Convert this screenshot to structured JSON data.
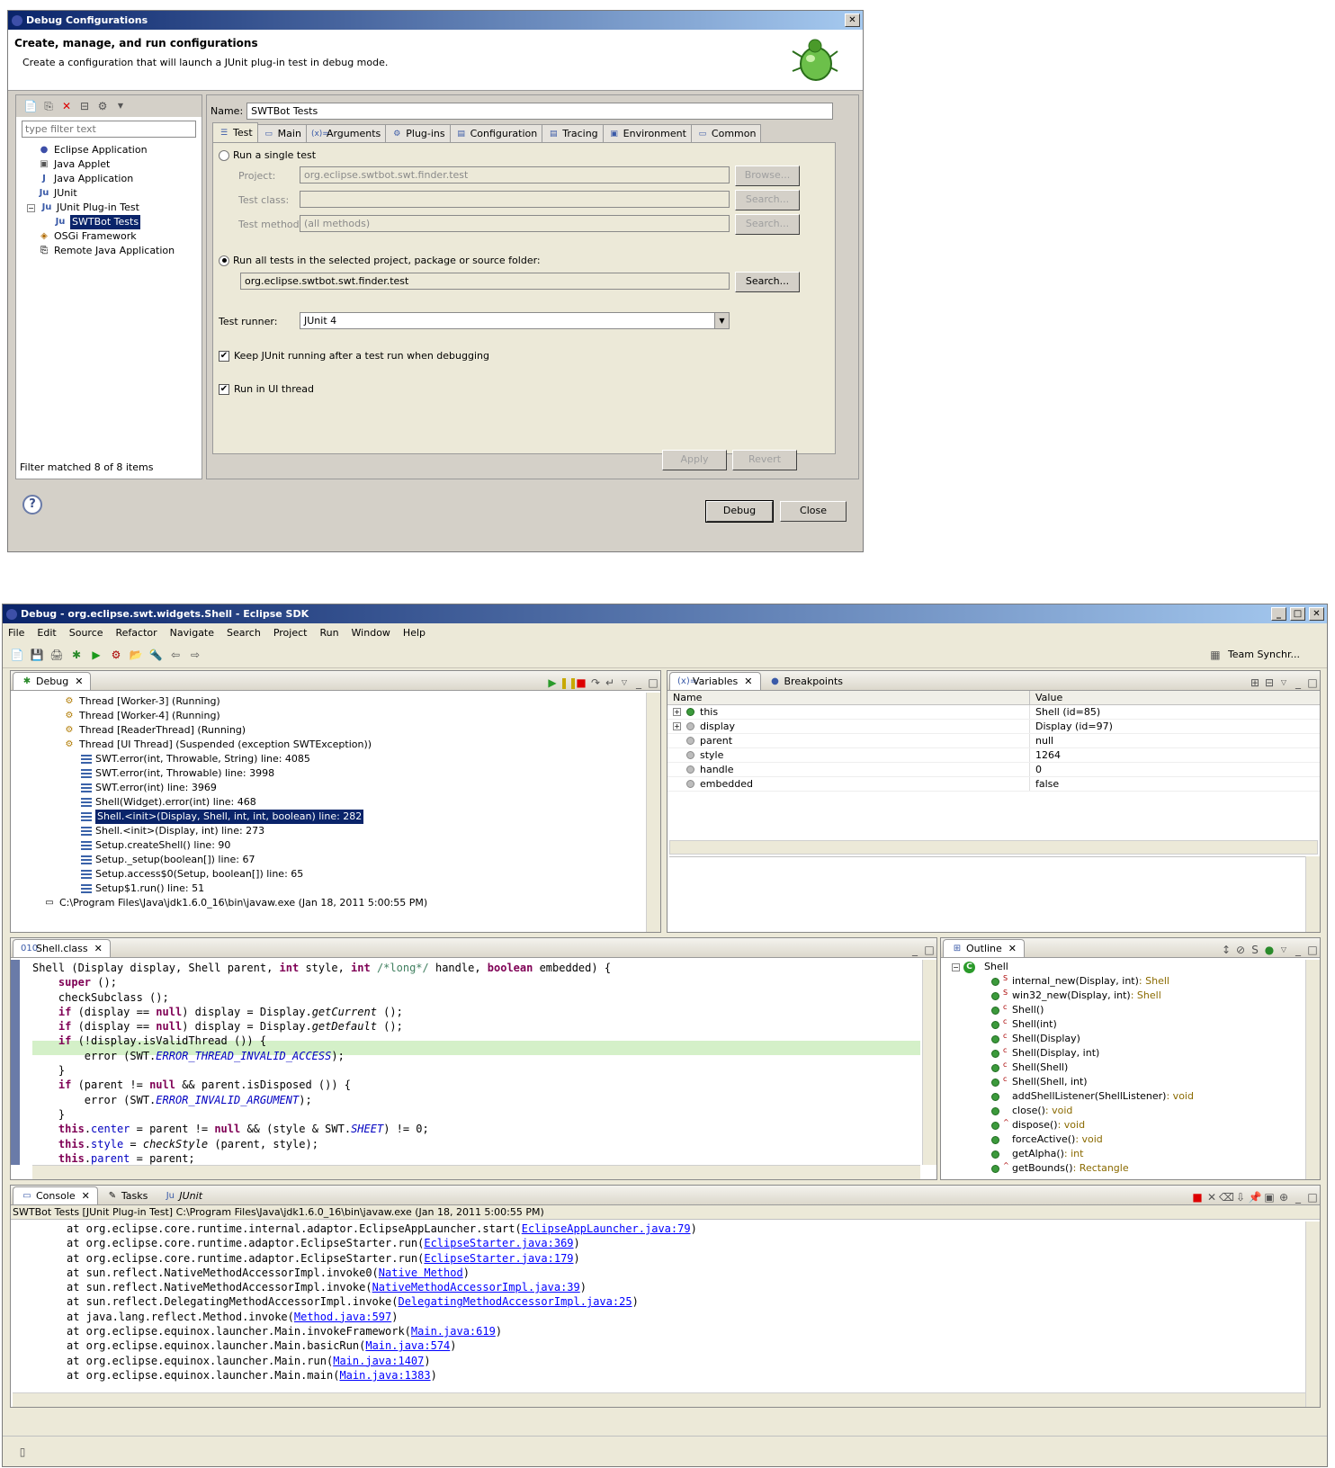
{
  "dialog": {
    "title": "Debug Configurations",
    "header_title": "Create, manage, and run configurations",
    "header_desc": "Create a configuration that will launch a JUnit plug-in test in debug mode.",
    "filter_placeholder": "type filter text",
    "tree": [
      {
        "label": "Eclipse Application",
        "icon": "eclipse-icon"
      },
      {
        "label": "Java Applet",
        "icon": "applet-icon"
      },
      {
        "label": "Java Application",
        "icon": "java-app-icon"
      },
      {
        "label": "JUnit",
        "icon": "junit-icon"
      },
      {
        "label": "JUnit Plug-in Test",
        "icon": "junit-plugin-icon"
      },
      {
        "label": "SWTBot Tests",
        "icon": "junit-plugin-icon"
      },
      {
        "label": "OSGi Framework",
        "icon": "osgi-icon"
      },
      {
        "label": "Remote Java Application",
        "icon": "remote-icon"
      }
    ],
    "filter_status": "Filter matched 8 of 8 items",
    "name_label": "Name:",
    "name_value": "SWTBot Tests",
    "tabs": [
      "Test",
      "Main",
      "Arguments",
      "Plug-ins",
      "Configuration",
      "Tracing",
      "Environment",
      "Common"
    ],
    "run_single": "Run a single test",
    "project_label": "Project:",
    "project_value": "org.eclipse.swtbot.swt.finder.test",
    "browse": "Browse...",
    "test_class_label": "Test class:",
    "search": "Search...",
    "test_method_label": "Test method:",
    "test_method_value": "(all methods)",
    "run_all": "Run all tests in the selected project, package or source folder:",
    "run_all_value": "org.eclipse.swtbot.swt.finder.test",
    "test_runner_label": "Test runner:",
    "test_runner_value": "JUnit 4",
    "keep_running": "Keep JUnit running after a test run when debugging",
    "run_ui_thread": "Run in UI thread",
    "apply": "Apply",
    "revert": "Revert",
    "debug": "Debug",
    "close": "Close"
  },
  "ide": {
    "title": "Debug - org.eclipse.swt.widgets.Shell - Eclipse SDK",
    "menu": [
      "File",
      "Edit",
      "Source",
      "Refactor",
      "Navigate",
      "Search",
      "Project",
      "Run",
      "Window",
      "Help"
    ],
    "perspective": "Team Synchr...",
    "debug_view": {
      "tab": "Debug",
      "rows": [
        {
          "text": "Thread [Worker-3] (Running)",
          "indent": 1,
          "type": "thread"
        },
        {
          "text": "Thread [Worker-4] (Running)",
          "indent": 1,
          "type": "thread"
        },
        {
          "text": "Thread [ReaderThread] (Running)",
          "indent": 1,
          "type": "thread"
        },
        {
          "text": "Thread [UI Thread] (Suspended (exception SWTException))",
          "indent": 1,
          "type": "thread-suspended"
        },
        {
          "text": "SWT.error(int, Throwable, String) line: 4085",
          "indent": 2,
          "type": "frame"
        },
        {
          "text": "SWT.error(int, Throwable) line: 3998",
          "indent": 2,
          "type": "frame"
        },
        {
          "text": "SWT.error(int) line: 3969",
          "indent": 2,
          "type": "frame"
        },
        {
          "text": "Shell(Widget).error(int) line: 468",
          "indent": 2,
          "type": "frame"
        },
        {
          "text": "Shell.<init>(Display, Shell, int, int, boolean) line: 282",
          "indent": 2,
          "type": "frame-selected"
        },
        {
          "text": "Shell.<init>(Display, int) line: 273",
          "indent": 2,
          "type": "frame"
        },
        {
          "text": "Setup.createShell() line: 90",
          "indent": 2,
          "type": "frame"
        },
        {
          "text": "Setup._setup(boolean[]) line: 67",
          "indent": 2,
          "type": "frame"
        },
        {
          "text": "Setup.access$0(Setup, boolean[]) line: 65",
          "indent": 2,
          "type": "frame"
        },
        {
          "text": "Setup$1.run() line: 51",
          "indent": 2,
          "type": "frame"
        },
        {
          "text": "C:\\Program Files\\Java\\jdk1.6.0_16\\bin\\javaw.exe (Jan 18, 2011 5:00:55 PM)",
          "indent": 0,
          "type": "process"
        }
      ]
    },
    "variables_view": {
      "tab_vars": "Variables",
      "tab_bp": "Breakpoints",
      "col_name": "Name",
      "col_value": "Value",
      "rows": [
        {
          "name": "this",
          "value": "Shell  (id=85)",
          "expand": true,
          "kind": "green"
        },
        {
          "name": "display",
          "value": "Display  (id=97)",
          "expand": true,
          "kind": "grey"
        },
        {
          "name": "parent",
          "value": "null",
          "expand": false,
          "kind": "grey"
        },
        {
          "name": "style",
          "value": "1264",
          "expand": false,
          "kind": "grey"
        },
        {
          "name": "handle",
          "value": "0",
          "expand": false,
          "kind": "grey"
        },
        {
          "name": "embedded",
          "value": "false",
          "expand": false,
          "kind": "grey"
        }
      ]
    },
    "editor": {
      "tab": "Shell.class"
    },
    "outline": {
      "tab": "Outline",
      "root": "Shell",
      "items": [
        {
          "name": "internal_new(Display, int)",
          "type": " : Shell",
          "mod": "S"
        },
        {
          "name": "win32_new(Display, int)",
          "type": " : Shell",
          "mod": "S"
        },
        {
          "name": "Shell()",
          "type": "",
          "mod": "c"
        },
        {
          "name": "Shell(int)",
          "type": "",
          "mod": "c"
        },
        {
          "name": "Shell(Display)",
          "type": "",
          "mod": "c"
        },
        {
          "name": "Shell(Display, int)",
          "type": "",
          "mod": "c"
        },
        {
          "name": "Shell(Shell)",
          "type": "",
          "mod": "c"
        },
        {
          "name": "Shell(Shell, int)",
          "type": "",
          "mod": "c"
        },
        {
          "name": "addShellListener(ShellListener)",
          "type": " : void",
          "mod": ""
        },
        {
          "name": "close()",
          "type": " : void",
          "mod": ""
        },
        {
          "name": "dispose()",
          "type": " : void",
          "mod": "^"
        },
        {
          "name": "forceActive()",
          "type": " : void",
          "mod": ""
        },
        {
          "name": "getAlpha()",
          "type": " : int",
          "mod": ""
        },
        {
          "name": "getBounds()",
          "type": " : Rectangle",
          "mod": "^"
        }
      ]
    },
    "console": {
      "tab_console": "Console",
      "tab_tasks": "Tasks",
      "tab_junit": "JUnit",
      "header": "SWTBot Tests [JUnit Plug-in Test] C:\\Program Files\\Java\\jdk1.6.0_16\\bin\\javaw.exe (Jan 18, 2011 5:00:55 PM)",
      "lines": [
        {
          "pre": "at org.eclipse.core.runtime.internal.adaptor.EclipseAppLauncher.start(",
          "link": "EclipseAppLauncher.java:79",
          "post": ")"
        },
        {
          "pre": "at org.eclipse.core.runtime.adaptor.EclipseStarter.run(",
          "link": "EclipseStarter.java:369",
          "post": ")"
        },
        {
          "pre": "at org.eclipse.core.runtime.adaptor.EclipseStarter.run(",
          "link": "EclipseStarter.java:179",
          "post": ")"
        },
        {
          "pre": "at sun.reflect.NativeMethodAccessorImpl.invoke0(",
          "link": "Native Method",
          "post": ")"
        },
        {
          "pre": "at sun.reflect.NativeMethodAccessorImpl.invoke(",
          "link": "NativeMethodAccessorImpl.java:39",
          "post": ")"
        },
        {
          "pre": "at sun.reflect.DelegatingMethodAccessorImpl.invoke(",
          "link": "DelegatingMethodAccessorImpl.java:25",
          "post": ")"
        },
        {
          "pre": "at java.lang.reflect.Method.invoke(",
          "link": "Method.java:597",
          "post": ")"
        },
        {
          "pre": "at org.eclipse.equinox.launcher.Main.invokeFramework(",
          "link": "Main.java:619",
          "post": ")"
        },
        {
          "pre": "at org.eclipse.equinox.launcher.Main.basicRun(",
          "link": "Main.java:574",
          "post": ")"
        },
        {
          "pre": "at org.eclipse.equinox.launcher.Main.run(",
          "link": "Main.java:1407",
          "post": ")"
        },
        {
          "pre": "at org.eclipse.equinox.launcher.Main.main(",
          "link": "Main.java:1383",
          "post": ")"
        }
      ]
    }
  }
}
